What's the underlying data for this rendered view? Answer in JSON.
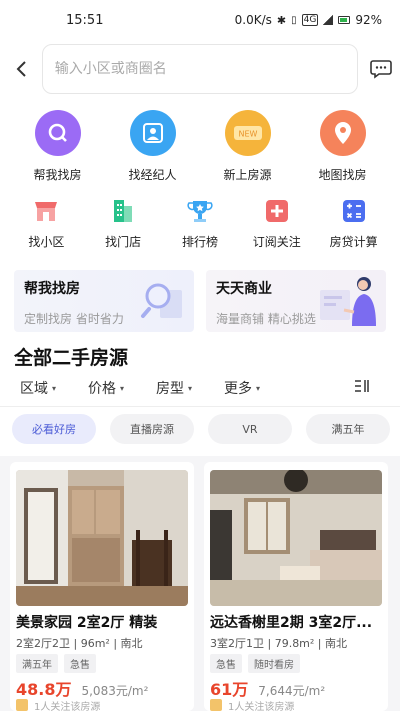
{
  "status_bar": {
    "time": "15:51",
    "network_speed": "0.0K/s",
    "network_type": "4G",
    "battery": "92%"
  },
  "search": {
    "placeholder": "输入小区或商圈名"
  },
  "main_grid": [
    {
      "label": "帮我找房",
      "icon": "search-icon",
      "color": "#9b6bf5"
    },
    {
      "label": "找经纪人",
      "icon": "agent-icon",
      "color": "#3aa5f2"
    },
    {
      "label": "新上房源",
      "icon": "new-badge-icon",
      "color": "#f5b43b"
    },
    {
      "label": "地图找房",
      "icon": "map-pin-icon",
      "color": "#f5835b"
    }
  ],
  "sub_grid": [
    {
      "label": "找小区",
      "icon": "shop-icon",
      "color": "#f06a6a"
    },
    {
      "label": "找门店",
      "icon": "building-icon",
      "color": "#27c28b"
    },
    {
      "label": "排行榜",
      "icon": "trophy-icon",
      "color": "#3aa5f2"
    },
    {
      "label": "订阅关注",
      "icon": "plus-icon",
      "color": "#f06a6a"
    },
    {
      "label": "房贷计算",
      "icon": "calculator-icon",
      "color": "#4b6ef0"
    }
  ],
  "promos": [
    {
      "title": "帮我找房",
      "subtitle": "定制找房  省时省力"
    },
    {
      "title": "天天商业",
      "subtitle": "海量商铺  精心挑选"
    }
  ],
  "section": {
    "title": "全部二手房源"
  },
  "filters": [
    {
      "label": "区域"
    },
    {
      "label": "价格"
    },
    {
      "label": "房型"
    },
    {
      "label": "更多"
    }
  ],
  "tags": [
    {
      "label": "必看好房",
      "active": true
    },
    {
      "label": "直播房源",
      "active": false
    },
    {
      "label": "VR",
      "active": false
    },
    {
      "label": "满五年",
      "active": false
    }
  ],
  "listings": [
    {
      "title": "美景家园 2室2厅 精装",
      "meta": "2室2厅2卫 | 96m² | 南北",
      "tags": [
        "满五年",
        "急售"
      ],
      "price_total": "48.8万",
      "price_unit": "5,083元/m²",
      "footnote": "1人关注该房源"
    },
    {
      "title": "远达香榭里2期 3室2厅...",
      "meta": "3室2厅1卫 | 79.8m² | 南北",
      "tags": [
        "急售",
        "随时看房"
      ],
      "price_total": "61万",
      "price_unit": "7,644元/m²",
      "footnote": "1人关注该房源"
    }
  ]
}
